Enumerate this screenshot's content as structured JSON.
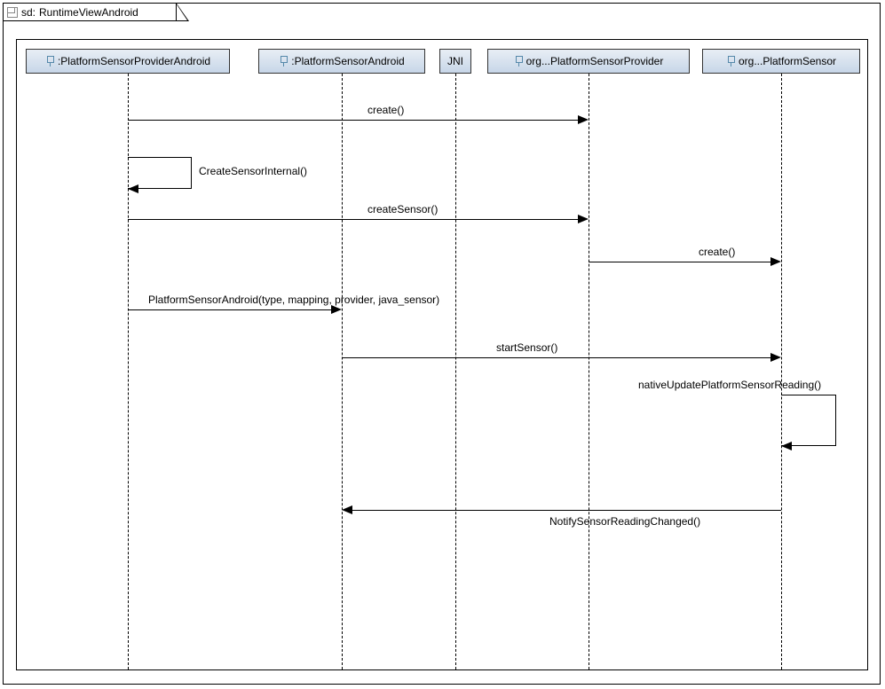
{
  "frame": {
    "prefix": "sd:",
    "title": "RuntimeViewAndroid"
  },
  "participants": {
    "p1": ":PlatformSensorProviderAndroid",
    "p2": ":PlatformSensorAndroid",
    "p3": "JNI",
    "p4": "org...PlatformSensorProvider",
    "p5": "org...PlatformSensor"
  },
  "messages": {
    "m1": "create()",
    "m2": "CreateSensorInternal()",
    "m3": "createSensor()",
    "m4": "create()",
    "m5": "PlatformSensorAndroid(type, mapping, provider, java_sensor)",
    "m6": "startSensor()",
    "m7": "nativeUpdatePlatformSensorReading()",
    "m8": "NotifySensorReadingChanged()"
  }
}
